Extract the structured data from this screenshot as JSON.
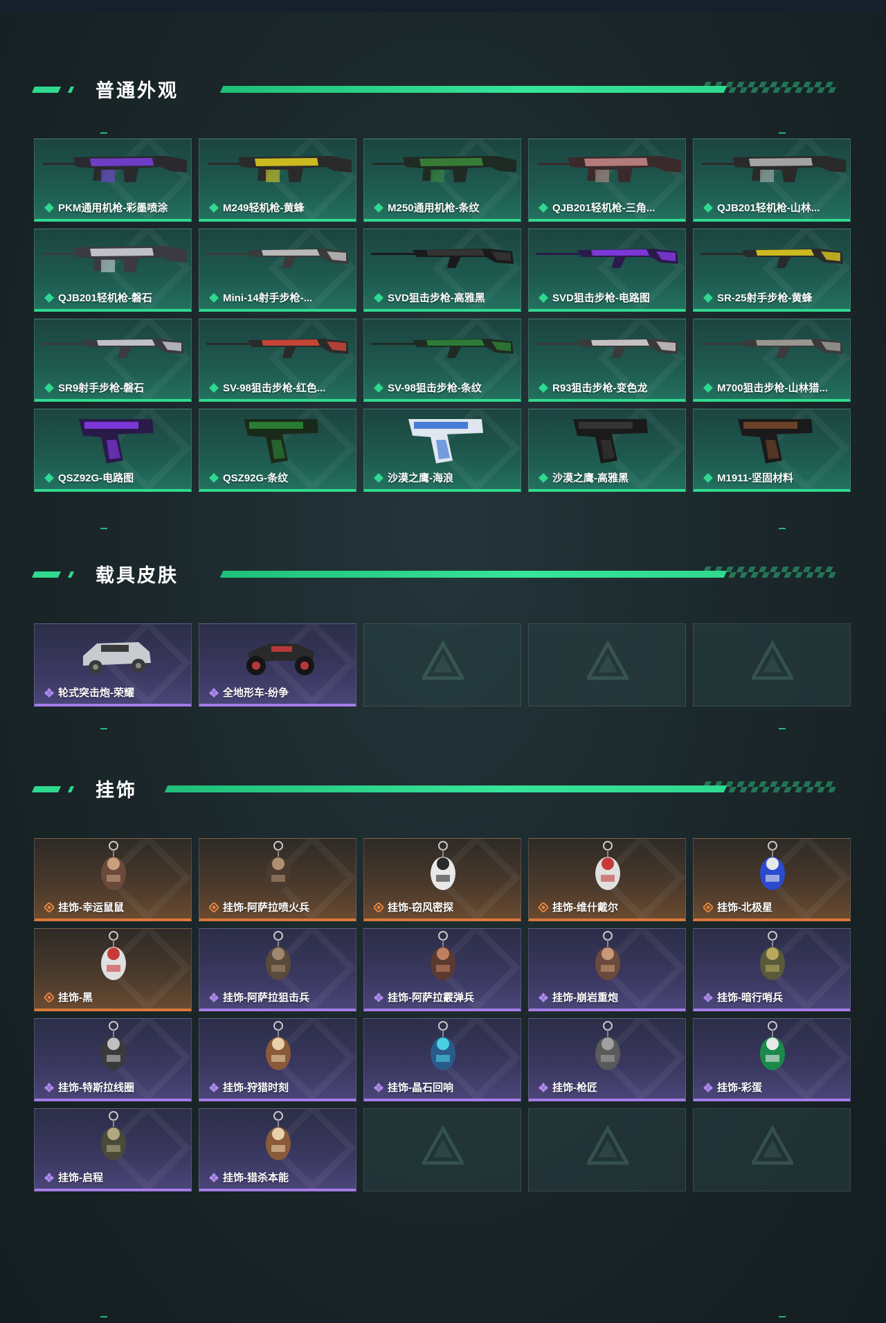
{
  "sections": {
    "weapons": {
      "title": "普通外观",
      "items": [
        {
          "label": "PKM通用机枪-彩墨喷涂",
          "kind": "weapon",
          "colors": [
            "#2a2a2e",
            "#7b3fe0"
          ]
        },
        {
          "label": "M249轻机枪-黄蜂",
          "kind": "weapon",
          "colors": [
            "#2a2a2a",
            "#e8d21e"
          ]
        },
        {
          "label": "M250通用机枪-条纹",
          "kind": "weapon",
          "colors": [
            "#1f2a22",
            "#3d8a3a"
          ]
        },
        {
          "label": "QJB201轻机枪-三角...",
          "kind": "weapon",
          "colors": [
            "#3a2a2c",
            "#c98a8a"
          ]
        },
        {
          "label": "QJB201轻机枪-山林...",
          "kind": "weapon",
          "colors": [
            "#2a2a2a",
            "#b8b8b8"
          ]
        },
        {
          "label": "QJB201轻机枪-磐石",
          "kind": "weapon",
          "colors": [
            "#3a3a40",
            "#d8d8e0"
          ]
        },
        {
          "label": "Mini-14射手步枪-...",
          "kind": "rifle",
          "colors": [
            "#3a3a3a",
            "#d0d0d0"
          ]
        },
        {
          "label": "SVD狙击步枪-高雅黑",
          "kind": "rifle",
          "colors": [
            "#1a1a1a",
            "#3a3a3a"
          ]
        },
        {
          "label": "SVD狙击步枪-电路图",
          "kind": "rifle",
          "colors": [
            "#2a1a4a",
            "#8a3ef0"
          ]
        },
        {
          "label": "SR-25射手步枪-黄蜂",
          "kind": "rifle",
          "colors": [
            "#2a2a2a",
            "#e8d21e"
          ]
        },
        {
          "label": "SR9射手步枪-磐石",
          "kind": "rifle",
          "colors": [
            "#3a3a40",
            "#d8d8e0"
          ]
        },
        {
          "label": "SV-98狙击步枪-红色...",
          "kind": "rifle",
          "colors": [
            "#2a2a2a",
            "#e04a3a"
          ]
        },
        {
          "label": "SV-98狙击步枪-条纹",
          "kind": "rifle",
          "colors": [
            "#1f2a22",
            "#2f8a3a"
          ]
        },
        {
          "label": "R93狙击步枪-变色龙",
          "kind": "rifle",
          "colors": [
            "#3a3a3a",
            "#e0d8dc"
          ]
        },
        {
          "label": "M700狙击步枪-山林猎...",
          "kind": "rifle",
          "colors": [
            "#3a3a3a",
            "#a8a8a0"
          ]
        },
        {
          "label": "QSZ92G-电路图",
          "kind": "pistol",
          "colors": [
            "#2a1a4a",
            "#8a3ef0"
          ]
        },
        {
          "label": "QSZ92G-条纹",
          "kind": "pistol",
          "colors": [
            "#1a2a1a",
            "#2f8a3a"
          ]
        },
        {
          "label": "沙漠之鹰-海浪",
          "kind": "pistol",
          "colors": [
            "#dfe6f0",
            "#2a6ad0"
          ]
        },
        {
          "label": "沙漠之鹰-高雅黑",
          "kind": "pistol",
          "colors": [
            "#1a1a1a",
            "#3a3a3a"
          ]
        },
        {
          "label": "M1911-坚固材料",
          "kind": "pistol",
          "colors": [
            "#1a1a1a",
            "#7a4a2a"
          ]
        }
      ]
    },
    "vehicles": {
      "title": "载具皮肤",
      "items": [
        {
          "label": "轮式突击炮-荣耀",
          "kind": "car",
          "colors": [
            "#c8ccd0",
            "#3a3a3a"
          ]
        },
        {
          "label": "全地形车-纷争",
          "kind": "atv",
          "colors": [
            "#2a2a2a",
            "#b8383a"
          ]
        }
      ],
      "empty_slots": 3
    },
    "charms": {
      "title": "挂饰",
      "items": [
        {
          "label": "挂饰-幸运鼠鼠",
          "rarity": "orange",
          "colors": [
            "#6a4a3a",
            "#c8a080"
          ]
        },
        {
          "label": "挂饰-阿萨拉喷火兵",
          "rarity": "orange",
          "colors": [
            "#4a3a30",
            "#b09070"
          ]
        },
        {
          "label": "挂饰-窃风密探",
          "rarity": "orange",
          "colors": [
            "#e8e8e8",
            "#2a2a2a"
          ]
        },
        {
          "label": "挂饰-维什戴尔",
          "rarity": "orange",
          "colors": [
            "#e0e0e0",
            "#c83a3a"
          ]
        },
        {
          "label": "挂饰-北极星",
          "rarity": "orange",
          "colors": [
            "#2a4ad0",
            "#e8e8e8"
          ]
        },
        {
          "label": "挂饰-黑",
          "rarity": "orange",
          "colors": [
            "#e0e0e0",
            "#c83a3a"
          ]
        },
        {
          "label": "挂饰-阿萨拉狙击兵",
          "rarity": "purple",
          "colors": [
            "#5a4a3a",
            "#a08870"
          ]
        },
        {
          "label": "挂饰-阿萨拉霰弹兵",
          "rarity": "purple",
          "colors": [
            "#5a3a30",
            "#c08060"
          ]
        },
        {
          "label": "挂饰-崩岩重炮",
          "rarity": "purple",
          "colors": [
            "#6a4a3a",
            "#c89878"
          ]
        },
        {
          "label": "挂饰-暗行哨兵",
          "rarity": "purple",
          "colors": [
            "#5a5a3a",
            "#b8a860"
          ]
        },
        {
          "label": "挂饰-特斯拉线圈",
          "rarity": "purple",
          "colors": [
            "#3a3a3a",
            "#c0c0c0"
          ]
        },
        {
          "label": "挂饰-狩猎时刻",
          "rarity": "purple",
          "colors": [
            "#8a5a3a",
            "#e8d0a8"
          ]
        },
        {
          "label": "挂饰-晶石回响",
          "rarity": "purple",
          "colors": [
            "#2a5a8a",
            "#4ad0e0"
          ]
        },
        {
          "label": "挂饰-枪匠",
          "rarity": "purple",
          "colors": [
            "#5a5a5a",
            "#a0a0a0"
          ]
        },
        {
          "label": "挂饰-彩蛋",
          "rarity": "purple",
          "colors": [
            "#1a8a4a",
            "#e8e8e8"
          ]
        },
        {
          "label": "挂饰-启程",
          "rarity": "purple",
          "colors": [
            "#4a4a3a",
            "#b0a880"
          ]
        },
        {
          "label": "挂饰-猎杀本能",
          "rarity": "purple",
          "colors": [
            "#8a5a3a",
            "#e8d0a8"
          ]
        }
      ],
      "empty_slots": 3
    }
  },
  "accents": {
    "green": "#2fd98f",
    "purple": "#a57be8",
    "orange": "#d9793a"
  }
}
